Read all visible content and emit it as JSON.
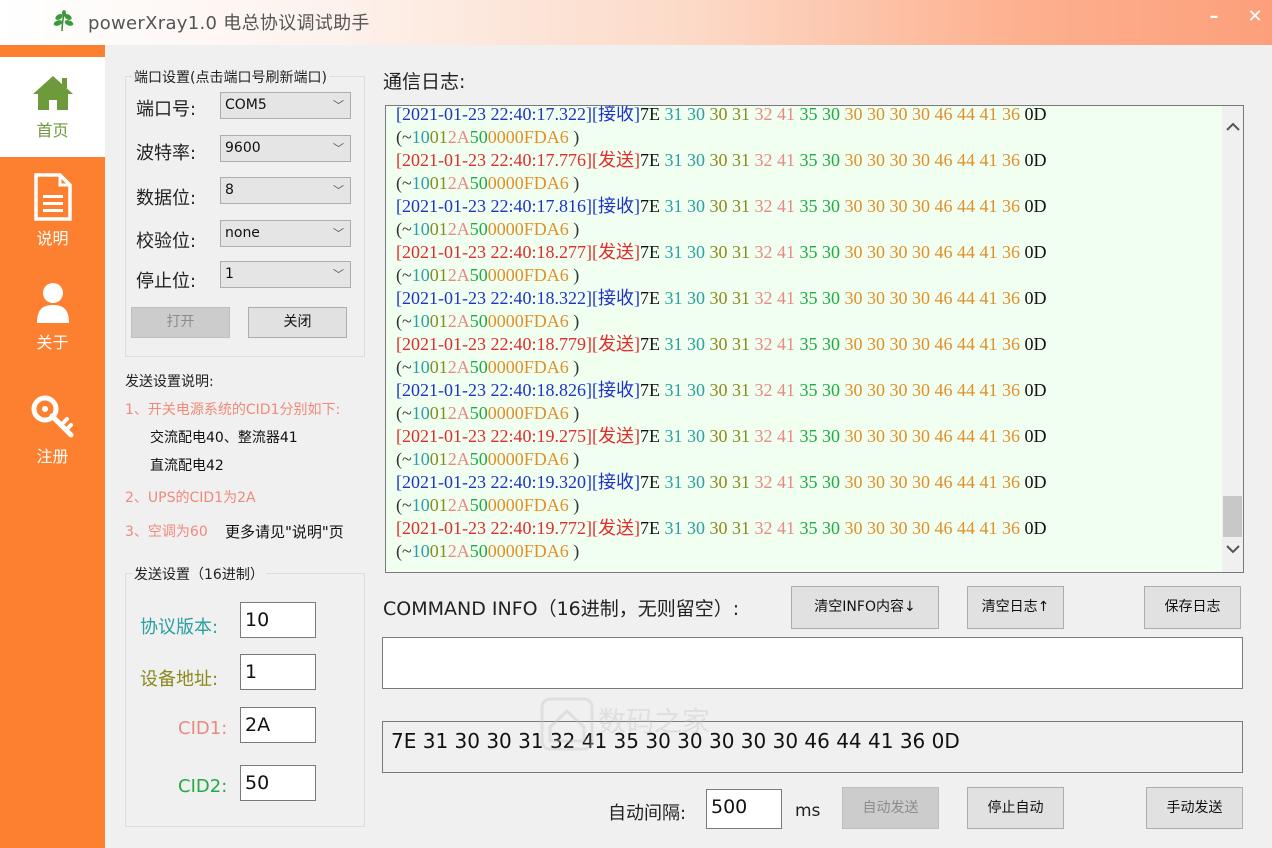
{
  "window": {
    "title": "powerXray1.0 电总协议调试助手",
    "minimize_label": "–",
    "close_label": "✕"
  },
  "sidebar": {
    "items": [
      {
        "label": "首页",
        "icon": "home-icon",
        "active": true
      },
      {
        "label": "说明",
        "icon": "document-icon",
        "active": false
      },
      {
        "label": "关于",
        "icon": "user-icon",
        "active": false
      },
      {
        "label": "注册",
        "icon": "key-icon",
        "active": false
      }
    ]
  },
  "port_settings": {
    "title": "端口设置(点击端口号刷新端口)",
    "fields": [
      {
        "label": "端口号:",
        "value": "COM5"
      },
      {
        "label": "波特率:",
        "value": "9600"
      },
      {
        "label": "数据位:",
        "value": "8"
      },
      {
        "label": "校验位:",
        "value": "none"
      },
      {
        "label": "停止位:",
        "value": "1"
      }
    ],
    "open_button": "打开",
    "close_button": "关闭"
  },
  "send_notes": {
    "title": "发送设置说明:",
    "line1": "1、开关电源系统的CID1分别如下:",
    "line1a": "交流配电40、整流器41",
    "line1b": "直流配电42",
    "line2": "2、UPS的CID1为2A",
    "line3": "3、空调为60",
    "line3_more": "更多请见\"说明\"页"
  },
  "send_settings": {
    "title": "发送设置（16进制）",
    "version_label": "协议版本:",
    "version_value": "10",
    "address_label": "设备地址:",
    "address_value": "1",
    "cid1_label": "CID1:",
    "cid1_value": "2A",
    "cid2_label": "CID2:",
    "cid2_value": "50"
  },
  "log": {
    "title": "通信日志:",
    "entries": [
      {
        "time": "[2021-01-23 22:40:17.322]",
        "dir": "[接收]",
        "type": "recv"
      },
      {
        "time": "[2021-01-23 22:40:17.776]",
        "dir": "[发送]",
        "type": "send"
      },
      {
        "time": "[2021-01-23 22:40:17.816]",
        "dir": "[接收]",
        "type": "recv"
      },
      {
        "time": "[2021-01-23 22:40:18.277]",
        "dir": "[发送]",
        "type": "send"
      },
      {
        "time": "[2021-01-23 22:40:18.322]",
        "dir": "[接收]",
        "type": "recv"
      },
      {
        "time": "[2021-01-23 22:40:18.779]",
        "dir": "[发送]",
        "type": "send"
      },
      {
        "time": "[2021-01-23 22:40:18.826]",
        "dir": "[接收]",
        "type": "recv"
      },
      {
        "time": "[2021-01-23 22:40:19.275]",
        "dir": "[发送]",
        "type": "send"
      },
      {
        "time": "[2021-01-23 22:40:19.320]",
        "dir": "[接收]",
        "type": "recv"
      },
      {
        "time": "[2021-01-23 22:40:19.772]",
        "dir": "[发送]",
        "type": "send"
      }
    ],
    "hex_segments": [
      {
        "text": "7E ",
        "color": "black"
      },
      {
        "text": "31 30 ",
        "color": "teal"
      },
      {
        "text": "30 31 ",
        "color": "olive"
      },
      {
        "text": "32 41 ",
        "color": "pink"
      },
      {
        "text": "35 30 ",
        "color": "green"
      },
      {
        "text": "30 30 30 30 46 44 41 36 ",
        "color": "orange"
      },
      {
        "text": "0D",
        "color": "black"
      }
    ],
    "ascii_segments": [
      {
        "text": "(~",
        "color": "dark"
      },
      {
        "text": "10",
        "color": "teal"
      },
      {
        "text": "01",
        "color": "olive"
      },
      {
        "text": "2A",
        "color": "pink"
      },
      {
        "text": "50",
        "color": "green"
      },
      {
        "text": "0000FDA6",
        "color": "orange"
      },
      {
        "text": " )",
        "color": "dark"
      }
    ],
    "scroll_position": 0.92
  },
  "command": {
    "label": "COMMAND INFO（16进制，无则留空）:",
    "clear_info_button": "清空INFO内容↓",
    "clear_log_button": "清空日志↑",
    "save_log_button": "保存日志",
    "info_value": "",
    "send_frame": "7E 31 30 30 31 32 41 35 30 30 30 30 30 46 44 41 36 0D"
  },
  "auto": {
    "interval_label": "自动间隔:",
    "interval_value": "500",
    "unit": "ms",
    "auto_send_button": "自动发送",
    "stop_auto_button": "停止自动",
    "manual_send_button": "手动发送"
  },
  "watermark": {
    "text": "数码之家"
  }
}
